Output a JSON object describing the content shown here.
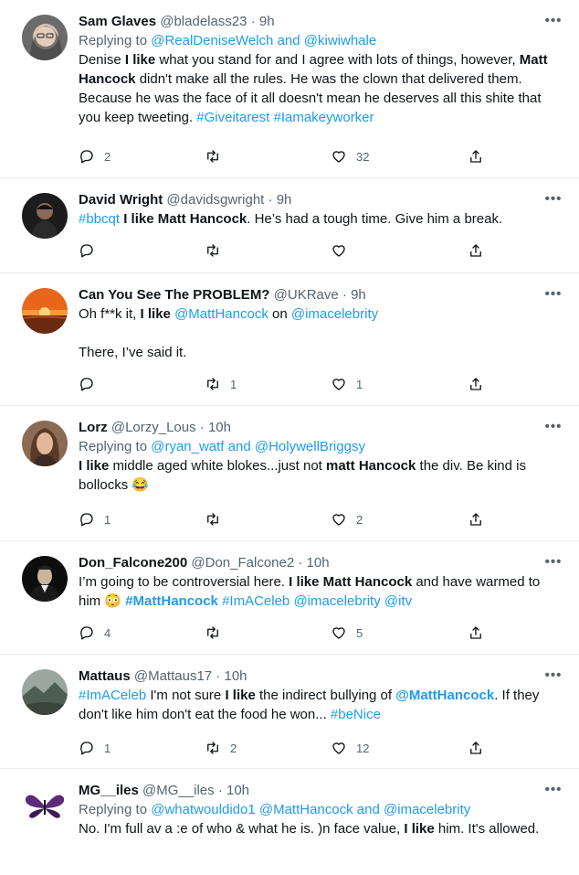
{
  "colors": {
    "link": "#1d9bf0",
    "secondary": "#536471",
    "text": "#0f1419",
    "divider": "#e6ecf0"
  },
  "tweets": [
    {
      "name": "Sam Glaves",
      "handle": "@bladelass23",
      "time": "9h",
      "replying_label": "Replying to",
      "replying_to_1": "@RealDeniseWelch",
      "replying_and": "and",
      "replying_to_2": "@kiwiwhale",
      "t1": "Denise ",
      "t2": "I like",
      "t3": " what you stand for and I agree with lots of things, however, ",
      "t4": "Matt Hancock",
      "t5": " didn't make all the rules. He was the clown that delivered them. Because he was the face of it all doesn't mean he deserves all this shite that you keep tweeting. ",
      "t6": "#Giveitarest",
      "t7": " ",
      "t8": "#Iamakeyworker",
      "replies": "2",
      "retweets": "",
      "likes": "32",
      "avatar_icon": "avatar-woman-glasses-icon"
    },
    {
      "name": "David Wright",
      "handle": "@davidsgwright",
      "time": "9h",
      "t1": "#bbcqt",
      "t2": " ",
      "t3": "I like Matt Hancock",
      "t4": ". He’s had a tough time. Give him a break.",
      "replies": "",
      "retweets": "",
      "likes": "",
      "avatar_icon": "avatar-man-dark-icon"
    },
    {
      "name": "Can You See The PROBLEM?",
      "handle": "@UKRave",
      "time": "9h",
      "t1": "Oh f**k it, ",
      "t2": "I like",
      "t3": " ",
      "t4": "@MattHancock",
      "t5": " on ",
      "t6": "@imacelebrity",
      "t7": "There, I’ve said it.",
      "replies": "",
      "retweets": "1",
      "likes": "1",
      "avatar_icon": "avatar-sunset-icon"
    },
    {
      "name": "Lorz",
      "handle": "@Lorzy_Lous",
      "time": "10h",
      "replying_label": "Replying to",
      "replying_to_1": "@ryan_watf",
      "replying_and": "and",
      "replying_to_2": "@HolywellBriggsy",
      "t1": "I like",
      "t2": " middle aged white blokes...just not ",
      "t3": "matt Hancock",
      "t4": " the div. Be kind is bollocks 😂",
      "replies": "1",
      "retweets": "",
      "likes": "2",
      "avatar_icon": "avatar-woman-icon"
    },
    {
      "name": "Don_Falcone200",
      "handle": "@Don_Falcone2",
      "time": "10h",
      "t1": "I’m going to be controversial here. ",
      "t2": "I like Matt Hancock",
      "t3": " and have warmed to him 😳 ",
      "t4": "#MattHancock",
      "t5": " ",
      "t6": "#ImACeleb",
      "t7": " ",
      "t8": "@imacelebrity",
      "t9": " ",
      "t10": "@itv",
      "replies": "4",
      "retweets": "",
      "likes": "5",
      "avatar_icon": "avatar-godfather-icon"
    },
    {
      "name": "Mattaus",
      "handle": "@Mattaus17",
      "time": "10h",
      "t1": "#ImACeleb",
      "t2": " I'm not sure ",
      "t3": "I like",
      "t4": " the indirect bullying of ",
      "t5": "@MattHancock",
      "t6": ". If they don't like him don't eat the food he won... ",
      "t7": "#beNice",
      "replies": "1",
      "retweets": "2",
      "likes": "12",
      "avatar_icon": "avatar-landscape-icon"
    },
    {
      "name": "MG__iles",
      "handle": "@MG__iles",
      "time": "10h",
      "replying_label": "Replying to",
      "replying_to_1": "@whatwouldido1",
      "replying_sep": " ",
      "replying_to_2": "@MattHancock",
      "replying_and": "and",
      "replying_to_3": "@imacelebrity",
      "t1": "No. I'm full  av a :e of who & what he is. )n face value, ",
      "t2": "I like",
      "t3": " him. It's allowed.",
      "avatar_icon": "avatar-butterfly-icon"
    }
  ],
  "sep_dot": "·",
  "more_glyph": "•••"
}
